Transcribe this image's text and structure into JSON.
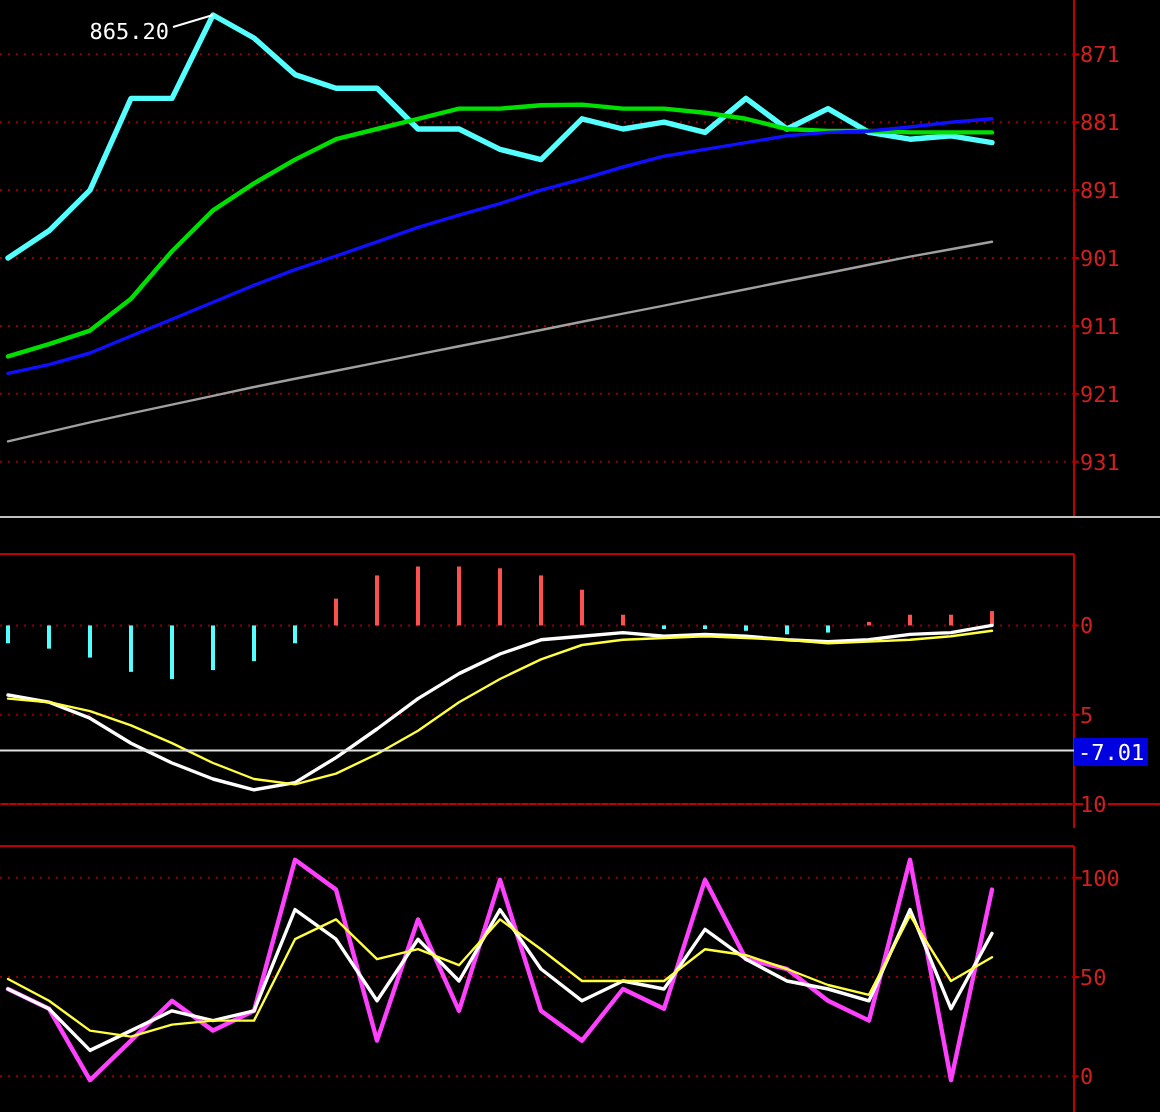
{
  "panels": [
    {
      "chart_data": {
        "type": "line",
        "ylim": [
          939,
          863
        ],
        "yticks": [
          871,
          881,
          891,
          901,
          911,
          921,
          931
        ],
        "grid": true,
        "series": [
          {
            "type": "line",
            "color": "#54ffff",
            "values": [
              901,
              897,
              891,
              877.5,
              877.5,
              865.2,
              868.6,
              874,
              876,
              876,
              882,
              882,
              885,
              886.5,
              880.5,
              882,
              881,
              882.5,
              877.5,
              882,
              879,
              882.5,
              883.5,
              883,
              884
            ]
          },
          {
            "type": "line",
            "color": "#00e000",
            "values": [
              915.5,
              913.7,
              911.7,
              907,
              900,
              894,
              890,
              886.5,
              883.5,
              882,
              880.5,
              879,
              879,
              878.5,
              878.4,
              879,
              879,
              879.6,
              880.5,
              882,
              882.3,
              882.3,
              882.5,
              882.5,
              882.5
            ]
          },
          {
            "type": "line",
            "color": "#1010ff",
            "values": [
              918,
              916.7,
              915,
              912.5,
              910,
              907.5,
              905,
              902.7,
              900.7,
              898.6,
              896.5,
              894.7,
              893,
              891,
              889.4,
              887.6,
              886,
              885,
              884,
              883,
              882.5,
              882.3,
              881.7,
              881,
              880.5
            ]
          },
          {
            "type": "line",
            "color": "#a0a0a0",
            "values": [
              928,
              926.6,
              925.2,
              923.9,
              922.6,
              921.3,
              920,
              918.8,
              917.6,
              916.4,
              915.2,
              914,
              912.8,
              911.6,
              910.4,
              909.2,
              908,
              906.8,
              905.6,
              904.4,
              903.2,
              902,
              900.8,
              899.7,
              898.6
            ]
          }
        ],
        "annotations": [
          "865.20"
        ]
      }
    },
    {
      "chart_data": {
        "type": "line",
        "ylim": [
          -10,
          4
        ],
        "yticks": [
          0,
          {
            "value": -5,
            "label": "5"
          },
          {
            "value": -10,
            "label": "10"
          }
        ],
        "grid": true,
        "series": [
          {
            "type": "bar",
            "colors": [
              "#54ffff",
              "#54ffff",
              "#54ffff",
              "#54ffff",
              "#54ffff",
              "#54ffff",
              "#54ffff",
              "#54ffff",
              "#ff5050",
              "#ff5050",
              "#ff5050",
              "#ff5050",
              "#ff5050",
              "#ff5050",
              "#ff5050",
              "#ff5050",
              "#54ffff",
              "#54ffff",
              "#54ffff",
              "#54ffff",
              "#54ffff",
              "#ff5050",
              "#ff5050",
              "#ff5050",
              "#ff5050"
            ],
            "values": [
              -1,
              -1.3,
              -1.8,
              -2.6,
              -3,
              -2.5,
              -2,
              -1,
              1.5,
              2.8,
              3.3,
              3.3,
              3.2,
              2.8,
              2,
              0.6,
              -0.2,
              -0.2,
              -0.3,
              -0.5,
              -0.4,
              0.2,
              0.6,
              0.6,
              0.8
            ]
          },
          {
            "type": "line",
            "color": "#ffffff",
            "values": [
              -3.9,
              -4.3,
              -5.2,
              -6.6,
              -7.7,
              -8.6,
              -9.2,
              -8.8,
              -7.4,
              -5.8,
              -4.1,
              -2.7,
              -1.6,
              -0.8,
              -0.6,
              -0.4,
              -0.6,
              -0.5,
              -0.6,
              -0.8,
              -0.9,
              -0.8,
              -0.5,
              -0.4,
              0
            ]
          },
          {
            "type": "line",
            "color": "#ffff40",
            "values": [
              -4.1,
              -4.3,
              -4.8,
              -5.6,
              -6.6,
              -7.7,
              -8.6,
              -8.9,
              -8.3,
              -7.2,
              -5.9,
              -4.3,
              -3,
              -1.9,
              -1.1,
              -0.8,
              -0.7,
              -0.6,
              -0.7,
              -0.8,
              -1,
              -0.9,
              -0.8,
              -0.6,
              -0.3
            ]
          }
        ],
        "ref_lines": [
          {
            "axis": "y",
            "value": -7.01,
            "label": "-7.01",
            "color": "#e0e0e0"
          }
        ]
      }
    },
    {
      "chart_data": {
        "type": "line",
        "ylim": [
          -18,
          116
        ],
        "yticks": [
          0,
          50,
          100
        ],
        "grid": true,
        "series": [
          {
            "type": "line",
            "color": "#ff40ff",
            "values": [
              44,
              34,
              -2,
              18,
              38,
              23,
              33,
              109,
              94,
              18,
              79,
              33,
              99,
              33,
              18,
              44,
              34,
              99,
              59,
              54,
              38,
              28,
              109,
              -2,
              94
            ]
          },
          {
            "type": "line",
            "color": "#ffffff",
            "values": [
              44,
              34,
              13,
              23,
              33,
              28,
              33,
              84,
              69,
              38,
              69,
              48,
              84,
              54,
              38,
              48,
              44,
              74,
              59,
              48,
              44,
              38,
              84,
              34,
              72
            ]
          },
          {
            "type": "line",
            "color": "#ffff40",
            "values": [
              49,
              38,
              23,
              20,
              26,
              28,
              28,
              69,
              79,
              59,
              64,
              56,
              79,
              64,
              48,
              48,
              48,
              64,
              61,
              54,
              46,
              41,
              81,
              48,
              60
            ]
          }
        ]
      }
    }
  ]
}
